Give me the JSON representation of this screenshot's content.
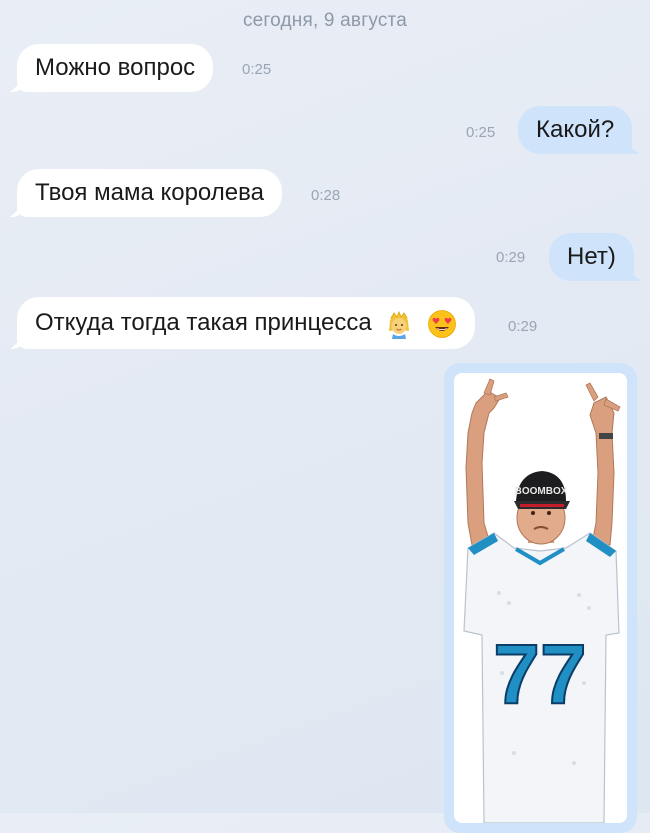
{
  "chat": {
    "date_separator": "сегодня, 9 августа",
    "messages": [
      {
        "direction": "in",
        "text": "Можно вопрос",
        "time": "0:25"
      },
      {
        "direction": "out",
        "text": "Какой?",
        "time": "0:25"
      },
      {
        "direction": "in",
        "text": "Твоя мама королева",
        "time": "0:28"
      },
      {
        "direction": "out",
        "text": "Нет)",
        "time": "0:29"
      },
      {
        "direction": "in",
        "text": "Откуда тогда такая принцесса",
        "time": "0:29",
        "emojis": [
          "princess-emoji-icon",
          "heart-eyes-emoji-icon"
        ]
      }
    ],
    "photo": {
      "direction": "out",
      "jersey_number": "77",
      "cap_text": "BOOMBOX"
    }
  },
  "colors": {
    "incoming_bubble": "#ffffff",
    "outgoing_bubble": "#cfe3fb",
    "timestamp": "#9aa6b4",
    "background": "#e4eaf3"
  }
}
